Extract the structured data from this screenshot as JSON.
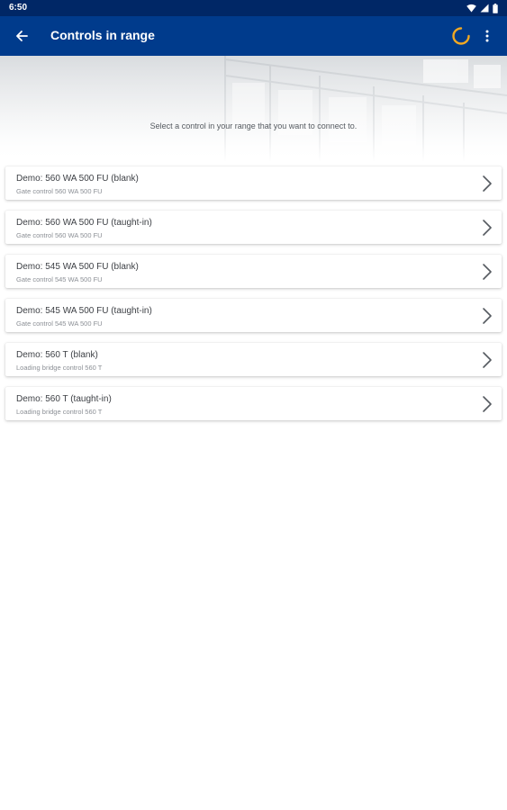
{
  "status_bar": {
    "time": "6:50",
    "icons": [
      "wifi-icon",
      "signal-icon",
      "battery-icon"
    ]
  },
  "app_bar": {
    "title": "Controls in range",
    "back_icon": "arrow-left-icon",
    "loading_icon": "spinner-icon",
    "menu_icon": "more-vert-icon"
  },
  "hero": {
    "instruction": "Select a control in your range that you want to connect to."
  },
  "controls": [
    {
      "title": "Demo: 560 WA 500 FU (blank)",
      "subtitle": "Gate control 560 WA 500 FU"
    },
    {
      "title": "Demo: 560 WA 500 FU (taught-in)",
      "subtitle": "Gate control 560 WA 500 FU"
    },
    {
      "title": "Demo: 545 WA 500 FU (blank)",
      "subtitle": "Gate control 545 WA 500 FU"
    },
    {
      "title": "Demo: 545 WA 500 FU (taught-in)",
      "subtitle": "Gate control 545 WA 500 FU"
    },
    {
      "title": "Demo: 560 T (blank)",
      "subtitle": "Loading bridge control 560 T"
    },
    {
      "title": "Demo: 560 T (taught-in)",
      "subtitle": "Loading bridge control 560 T"
    }
  ],
  "colors": {
    "status_bar": "#002766",
    "app_bar": "#003b8c",
    "spinner": "#f0a823",
    "background": "#ffffff"
  }
}
